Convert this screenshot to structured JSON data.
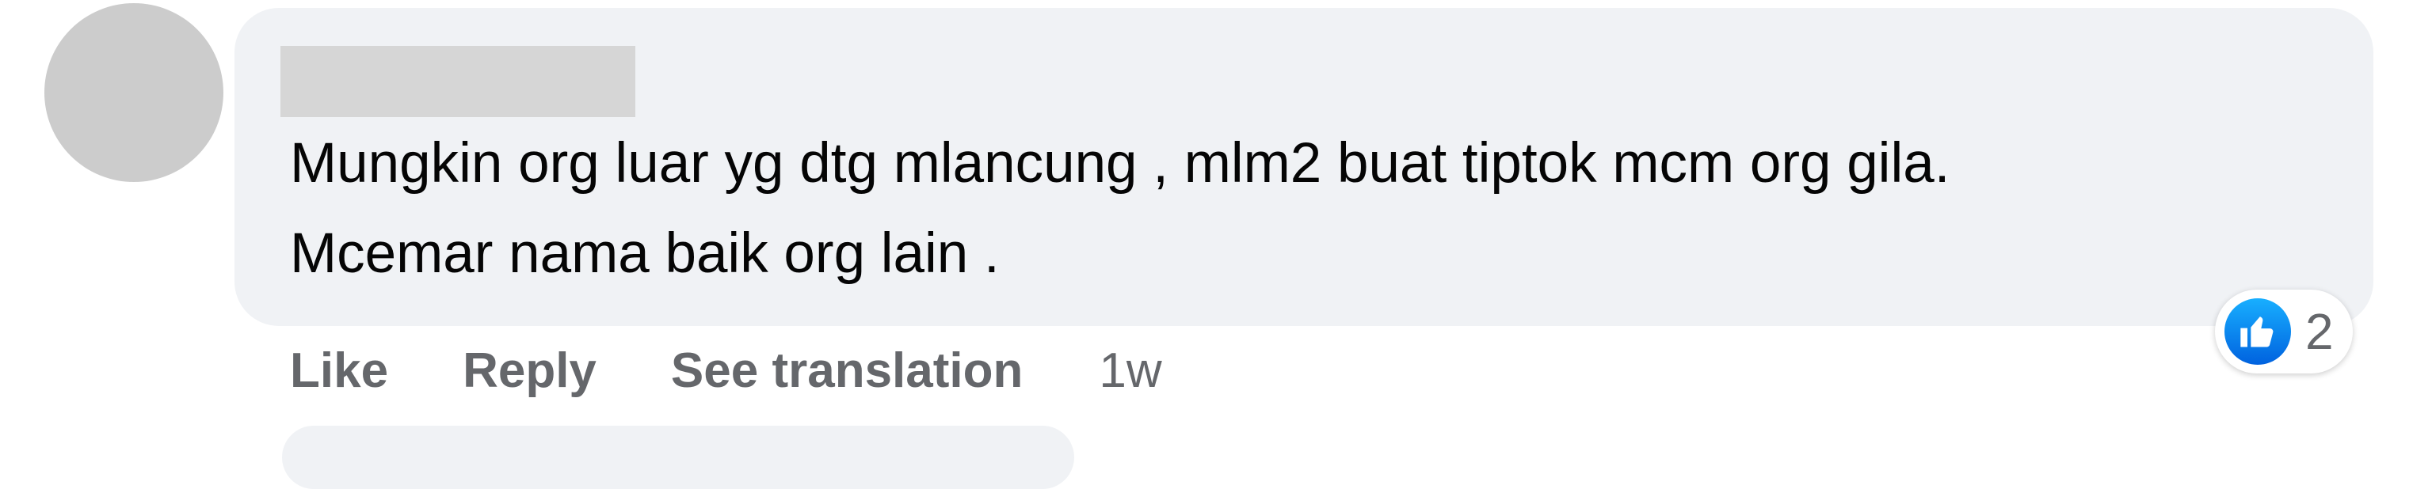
{
  "comment": {
    "author_name": "",
    "text": "Mungkin org luar yg dtg mlancung , mlm2 buat tiptok mcm org gila.\nMcemar nama baik org lain .",
    "reaction": {
      "icon": "like-icon",
      "count": "2",
      "color": "#1877f2"
    },
    "actions": {
      "like_label": "Like",
      "reply_label": "Reply",
      "translate_label": "See translation",
      "timestamp": "1w"
    }
  },
  "colors": {
    "bubble_bg": "#f0f2f5",
    "avatar_placeholder": "#cccccc",
    "meta_text": "#65676b",
    "body_text": "#050505"
  }
}
